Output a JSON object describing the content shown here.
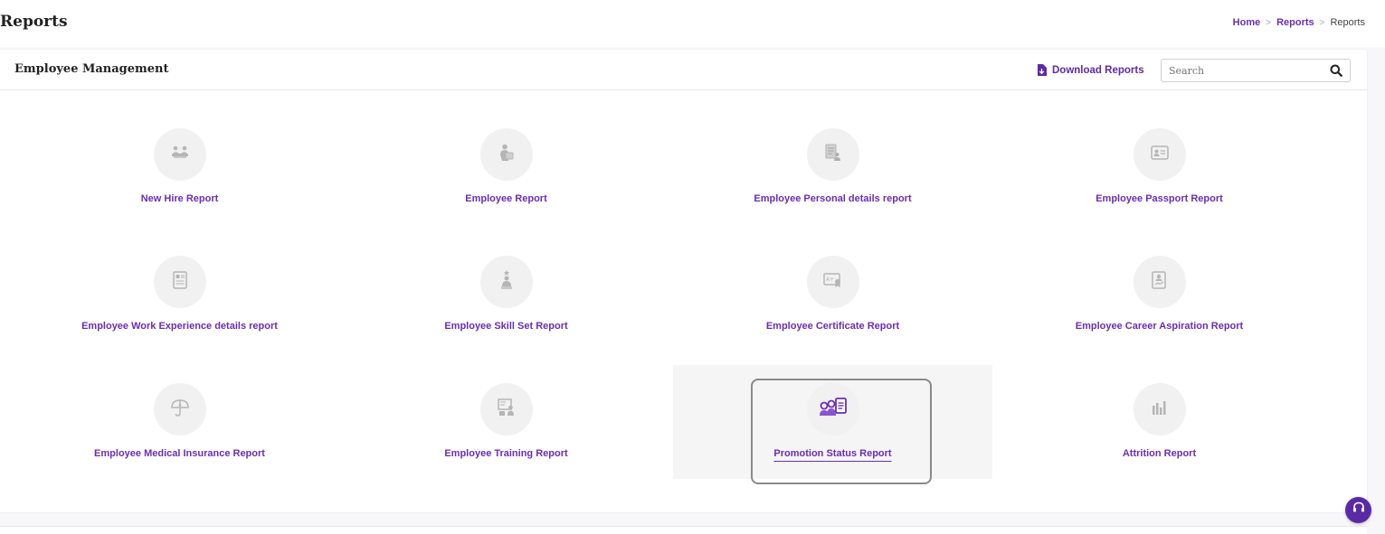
{
  "page": {
    "title": "Reports",
    "breadcrumb": [
      {
        "label": "Home"
      },
      {
        "label": "Reports"
      },
      {
        "label": "Reports"
      }
    ]
  },
  "section": {
    "title": "Employee Management",
    "download_label": "Download Reports",
    "search_placeholder": "Search"
  },
  "reports": [
    {
      "label": "New Hire Report",
      "icon": "people-handshake-icon"
    },
    {
      "label": "Employee Report",
      "icon": "employee-id-icon"
    },
    {
      "label": "Employee Personal details report",
      "icon": "personal-details-icon"
    },
    {
      "label": "Employee Passport Report",
      "icon": "passport-card-icon"
    },
    {
      "label": "Employee Work Experience details report",
      "icon": "work-experience-icon"
    },
    {
      "label": "Employee Skill Set Report",
      "icon": "skill-set-icon"
    },
    {
      "label": "Employee Certificate Report",
      "icon": "certificate-icon"
    },
    {
      "label": "Employee Career Aspiration Report",
      "icon": "career-aspiration-icon"
    },
    {
      "label": "Employee Medical Insurance Report",
      "icon": "umbrella-icon"
    },
    {
      "label": "Employee Training Report",
      "icon": "training-board-icon"
    },
    {
      "label": "Promotion Status Report",
      "icon": "promotion-people-icon",
      "active": true
    },
    {
      "label": "Attrition Report",
      "icon": "bar-chart-icon"
    }
  ],
  "colors": {
    "accent": "#6a2db5",
    "icon_gray": "#b5b5b5",
    "active_icon": "#6a2db5"
  }
}
